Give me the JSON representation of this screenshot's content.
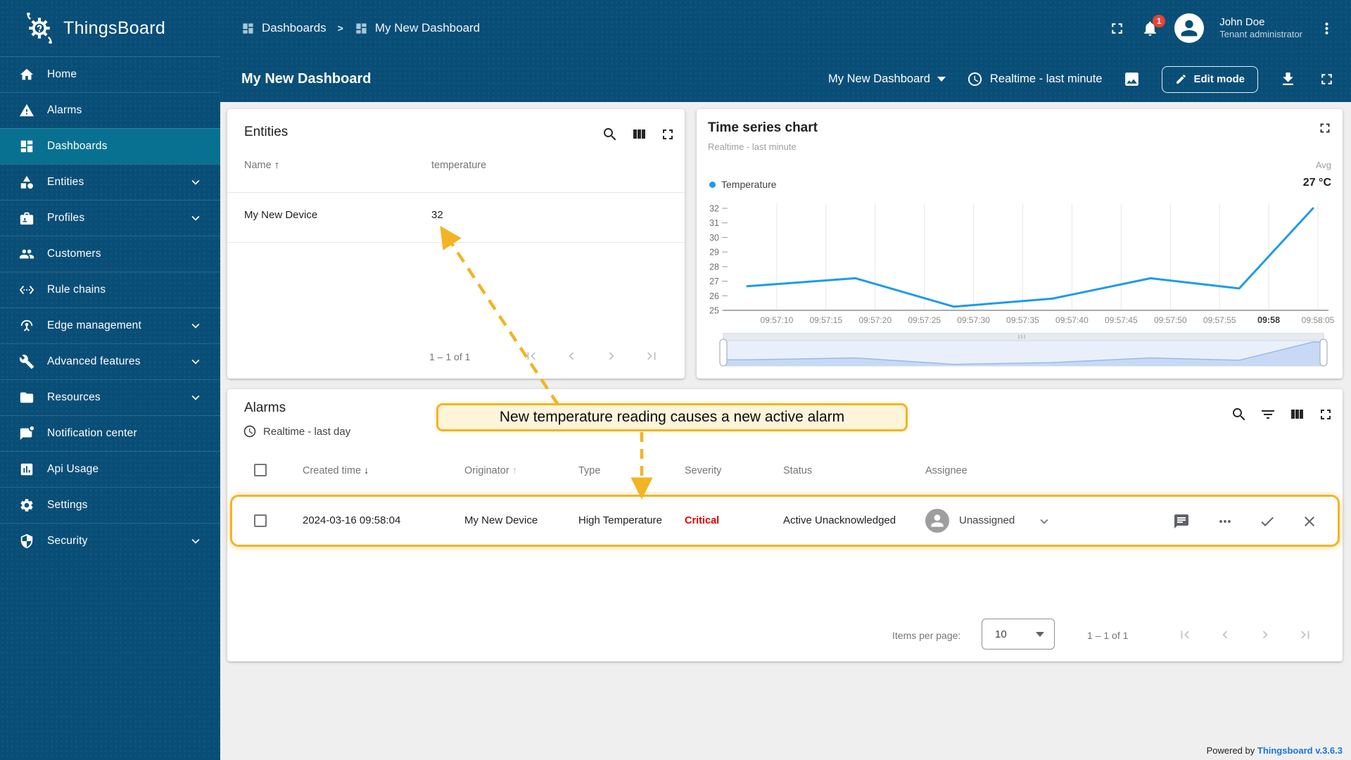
{
  "theme": {
    "primary": "#094e77",
    "primary_active": "#087191",
    "accent": "#F2B424",
    "critical": "#E00000",
    "link": "#1976D2",
    "chart_line": "#1E9BE9",
    "content_bg": "#EFEFEF"
  },
  "sidebar": {
    "logo_text": "ThingsBoard",
    "items": [
      {
        "label": "Home",
        "icon": "home-icon"
      },
      {
        "label": "Alarms",
        "icon": "warning-icon"
      },
      {
        "label": "Dashboards",
        "icon": "dashboards-icon",
        "active": true
      },
      {
        "label": "Entities",
        "icon": "entities-icon",
        "expandable": true
      },
      {
        "label": "Profiles",
        "icon": "profiles-icon",
        "expandable": true
      },
      {
        "label": "Customers",
        "icon": "customers-icon"
      },
      {
        "label": "Rule chains",
        "icon": "rule-chains-icon"
      },
      {
        "label": "Edge management",
        "icon": "edge-antenna-icon",
        "expandable": true
      },
      {
        "label": "Advanced features",
        "icon": "tools-icon",
        "expandable": true
      },
      {
        "label": "Resources",
        "icon": "folder-icon",
        "expandable": true
      },
      {
        "label": "Notification center",
        "icon": "notification-icon"
      },
      {
        "label": "Api Usage",
        "icon": "bar-chart-icon"
      },
      {
        "label": "Settings",
        "icon": "gear-icon"
      },
      {
        "label": "Security",
        "icon": "shield-icon",
        "expandable": true
      }
    ]
  },
  "header": {
    "breadcrumb": {
      "parent": "Dashboards",
      "separator": ">",
      "current": "My New Dashboard"
    },
    "notifications_badge": "1",
    "user": {
      "name": "John Doe",
      "role": "Tenant administrator"
    }
  },
  "toolbar": {
    "title": "My New Dashboard",
    "dashboard_select": "My New Dashboard",
    "timewindow": "Realtime - last minute",
    "edit_button": "Edit mode"
  },
  "entities_widget": {
    "title": "Entities",
    "columns": {
      "name": "Name",
      "telemetry": "temperature"
    },
    "name_sort_arrow": "↑",
    "rows": [
      {
        "name": "My New Device",
        "temperature": "32"
      }
    ],
    "pagination_range": "1 – 1 of 1"
  },
  "timeseries_widget": {
    "title": "Time series chart",
    "subtitle": "Realtime - last minute",
    "legend_series": "Temperature",
    "agg_header": "Avg",
    "agg_value": "27 °C"
  },
  "chart_data": {
    "type": "line",
    "title": "Time series chart",
    "legend": [
      "Temperature"
    ],
    "legend_position": "top-left",
    "grid": "vertical",
    "x_unit": "seconds after 09:57:00",
    "x_range": [
      5,
      65.5
    ],
    "ylim": [
      25,
      32
    ],
    "y_ticks": [
      25,
      26,
      27,
      28,
      29,
      30,
      31,
      32
    ],
    "x_ticks": [
      {
        "t": 10,
        "label": "09:57:10"
      },
      {
        "t": 15,
        "label": "09:57:15"
      },
      {
        "t": 20,
        "label": "09:57:20"
      },
      {
        "t": 25,
        "label": "09:57:25"
      },
      {
        "t": 30,
        "label": "09:57:30"
      },
      {
        "t": 35,
        "label": "09:57:35"
      },
      {
        "t": 40,
        "label": "09:57:40"
      },
      {
        "t": 45,
        "label": "09:57:45"
      },
      {
        "t": 50,
        "label": "09:57:50"
      },
      {
        "t": 55,
        "label": "09:57:55"
      },
      {
        "t": 60,
        "label": "09:58",
        "bold": true
      },
      {
        "t": 65,
        "label": "09:58:05"
      }
    ],
    "series": [
      {
        "name": "Temperature",
        "points": [
          [
            7,
            26.65
          ],
          [
            18,
            27.2
          ],
          [
            28,
            25.25
          ],
          [
            38,
            25.8
          ],
          [
            48,
            27.2
          ],
          [
            57,
            26.5
          ],
          [
            64.5,
            32
          ]
        ],
        "avg": "27 °C"
      }
    ]
  },
  "alarms_widget": {
    "title": "Alarms",
    "subtitle": "Realtime - last day",
    "columns": [
      "Created time",
      "Originator",
      "Type",
      "Severity",
      "Status",
      "Assignee"
    ],
    "created_sort_arrow": "↓",
    "originator_sort_arrow": "↑",
    "rows": [
      {
        "created_time": "2024-03-16 09:58:04",
        "originator": "My New Device",
        "type": "High Temperature",
        "severity": "Critical",
        "status": "Active Unacknowledged",
        "assignee": "Unassigned"
      }
    ],
    "footer": {
      "items_per_page_label": "Items per page:",
      "items_per_page_value": "10",
      "range": "1 – 1 of 1"
    }
  },
  "annotation": {
    "callout": "New temperature reading causes a new active alarm"
  },
  "page_footer": {
    "powered_by": "Powered by",
    "version_link": "Thingsboard v.3.6.3"
  },
  "icons": [
    "logo-gear-bug-icon",
    "home-icon",
    "warning-icon",
    "dashboards-icon",
    "entities-icon",
    "profiles-icon",
    "customers-icon",
    "rule-chains-icon",
    "edge-antenna-icon",
    "tools-icon",
    "folder-icon",
    "notification-icon",
    "bar-chart-icon",
    "gear-icon",
    "shield-icon",
    "chevron-down-icon",
    "fullscreen-icon",
    "bell-icon",
    "account-icon",
    "kebab-menu-icon",
    "image-icon",
    "pencil-icon",
    "download-icon",
    "clock-icon",
    "search-icon",
    "filter-icon",
    "columns-icon",
    "comment-icon",
    "check-icon",
    "close-icon",
    "first-page-icon",
    "prev-page-icon",
    "next-page-icon",
    "last-page-icon"
  ]
}
